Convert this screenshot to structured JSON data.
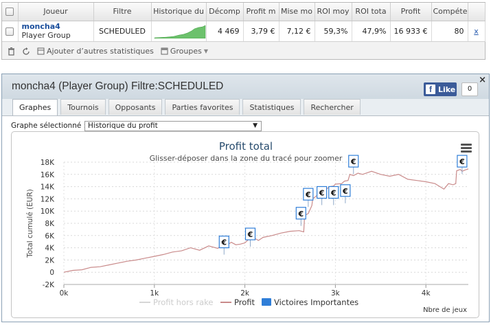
{
  "table": {
    "headers": [
      "Joueur",
      "Filtre",
      "Historique du",
      "Décomp",
      "Profit m",
      "Mise mo",
      "ROI moy",
      "ROI tota",
      "Profit",
      "Compéte"
    ],
    "row": {
      "player_name": "moncha4",
      "player_group": "Player Group",
      "filter": "SCHEDULED",
      "count": "4 469",
      "avg_profit": "3,79 €",
      "avg_stake": "7,12 €",
      "avg_roi": "59,3%",
      "total_roi": "47,9%",
      "profit": "16 933 €",
      "competence": "80",
      "remove_link": "x"
    }
  },
  "toolbar": {
    "add_stats_label": "Ajouter d’autres statistiques",
    "groups_label": "Groupes"
  },
  "window": {
    "title": "moncha4 (Player Group) Filtre:SCHEDULED",
    "like_label": "Like",
    "like_count": "0",
    "close_label": "×",
    "tabs": [
      "Graphes",
      "Tournois",
      "Opposants",
      "Parties favorites",
      "Statistiques",
      "Rechercher"
    ],
    "active_tab": 0,
    "graph_select_label": "Graphe sélectionné :",
    "graph_select_value": "Historique du profit"
  },
  "chart_data": {
    "type": "line",
    "title": "Profit total",
    "subtitle": "Glisser-déposer dans la zone du tracé pour zoomer",
    "ylabel": "Total cumulé (EUR)",
    "xlabel": "Nbre de jeux",
    "xlim": [
      0,
      4469
    ],
    "ylim": [
      -2000,
      18000
    ],
    "x_ticks": [
      0,
      1000,
      2000,
      3000,
      4000
    ],
    "x_tick_labels": [
      "0k",
      "1k",
      "2k",
      "3k",
      "4k"
    ],
    "y_ticks": [
      -2000,
      0,
      2000,
      4000,
      6000,
      8000,
      10000,
      12000,
      14000,
      16000,
      18000
    ],
    "y_tick_labels": [
      "-2K",
      "0",
      "2K",
      "4K",
      "6K",
      "8K",
      "10K",
      "12K",
      "14K",
      "16K",
      "18K"
    ],
    "grid": true,
    "legend_position": "bottom",
    "colors": {
      "profit": "#c98a8a",
      "rakeless": "#d6d6d6",
      "victories": "#2f7ed8"
    },
    "series": [
      {
        "name": "Profit hors rake",
        "x": [],
        "y": []
      },
      {
        "name": "Profit",
        "x": [
          0,
          100,
          200,
          300,
          400,
          500,
          600,
          700,
          800,
          900,
          1000,
          1100,
          1200,
          1300,
          1400,
          1500,
          1600,
          1700,
          1750,
          1800,
          1850,
          1900,
          1950,
          2000,
          2050,
          2100,
          2150,
          2200,
          2300,
          2400,
          2500,
          2600,
          2650,
          2660,
          2700,
          2740,
          2750,
          2800,
          2880,
          2900,
          2940,
          2980,
          3000,
          3070,
          3100,
          3140,
          3160,
          3200,
          3250,
          3300,
          3400,
          3500,
          3600,
          3700,
          3800,
          3900,
          4000,
          4100,
          4200,
          4250,
          4300,
          4330,
          4340,
          4380,
          4400,
          4430,
          4469
        ],
        "y": [
          0,
          300,
          400,
          800,
          900,
          1200,
          1500,
          1800,
          2000,
          2300,
          2600,
          2900,
          3300,
          3500,
          4000,
          3600,
          4300,
          3900,
          4500,
          4400,
          4900,
          4500,
          4600,
          4800,
          5500,
          5600,
          5200,
          5700,
          6000,
          6400,
          6700,
          6800,
          6600,
          9300,
          9600,
          10900,
          12000,
          12600,
          13500,
          13600,
          14000,
          14100,
          14400,
          14500,
          14900,
          15000,
          16000,
          15800,
          16200,
          16000,
          16500,
          16000,
          15700,
          16000,
          15200,
          15000,
          14800,
          14500,
          13600,
          14500,
          14300,
          14500,
          16600,
          16800,
          16500,
          16700,
          16900
        ]
      }
    ],
    "victories": [
      {
        "x": 1770,
        "y": 4900,
        "label": "€"
      },
      {
        "x": 2060,
        "y": 6200,
        "label": "€"
      },
      {
        "x": 2620,
        "y": 9600,
        "label": "€"
      },
      {
        "x": 2700,
        "y": 12700,
        "label": "€"
      },
      {
        "x": 2850,
        "y": 13000,
        "label": "€"
      },
      {
        "x": 2980,
        "y": 13000,
        "label": "€"
      },
      {
        "x": 3110,
        "y": 13300,
        "label": "€"
      },
      {
        "x": 4400,
        "y": 18100,
        "label": "€"
      },
      {
        "x": 3200,
        "y": 18100,
        "label": "€"
      }
    ]
  }
}
